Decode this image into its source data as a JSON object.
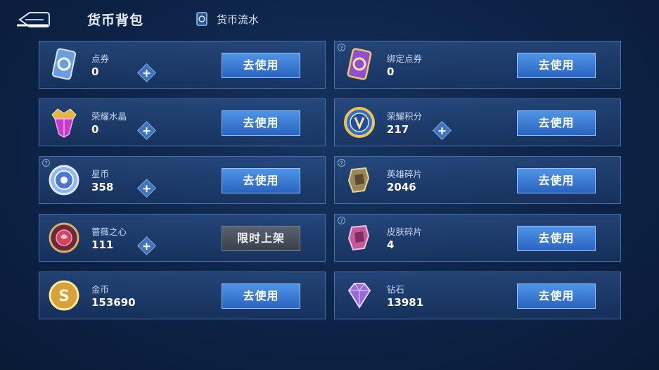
{
  "header": {
    "title": "货币背包",
    "flow_label": "货币流水"
  },
  "items": [
    {
      "name": "点券",
      "amount": "0",
      "has_plus": true,
      "button": "去使用",
      "icon": "coupon-icon"
    },
    {
      "name": "绑定点券",
      "amount": "0",
      "has_plus": false,
      "button": "去使用",
      "icon": "bound-coupon-icon"
    },
    {
      "name": "荣耀水晶",
      "amount": "0",
      "has_plus": true,
      "button": "去使用",
      "icon": "glory-crystal-icon"
    },
    {
      "name": "荣耀积分",
      "amount": "217",
      "has_plus": true,
      "button": "去使用",
      "icon": "glory-points-icon"
    },
    {
      "name": "星币",
      "amount": "358",
      "has_plus": true,
      "button": "去使用",
      "icon": "star-coin-icon"
    },
    {
      "name": "英雄碎片",
      "amount": "2046",
      "has_plus": false,
      "button": "去使用",
      "icon": "hero-fragment-icon"
    },
    {
      "name": "蔷薇之心",
      "amount": "111",
      "has_plus": true,
      "button": "限时上架",
      "icon": "rose-heart-icon"
    },
    {
      "name": "皮肤碎片",
      "amount": "4",
      "has_plus": false,
      "button": "去使用",
      "icon": "skin-fragment-icon"
    },
    {
      "name": "金币",
      "amount": "153690",
      "has_plus": false,
      "button": "去使用",
      "icon": "gold-coin-icon"
    },
    {
      "name": "钻石",
      "amount": "13981",
      "has_plus": false,
      "button": "去使用",
      "icon": "diamond-icon"
    }
  ],
  "colors": {
    "accent": "#2f6fd0",
    "panel_border": "#709cda",
    "disabled_button": "#4a525f"
  }
}
